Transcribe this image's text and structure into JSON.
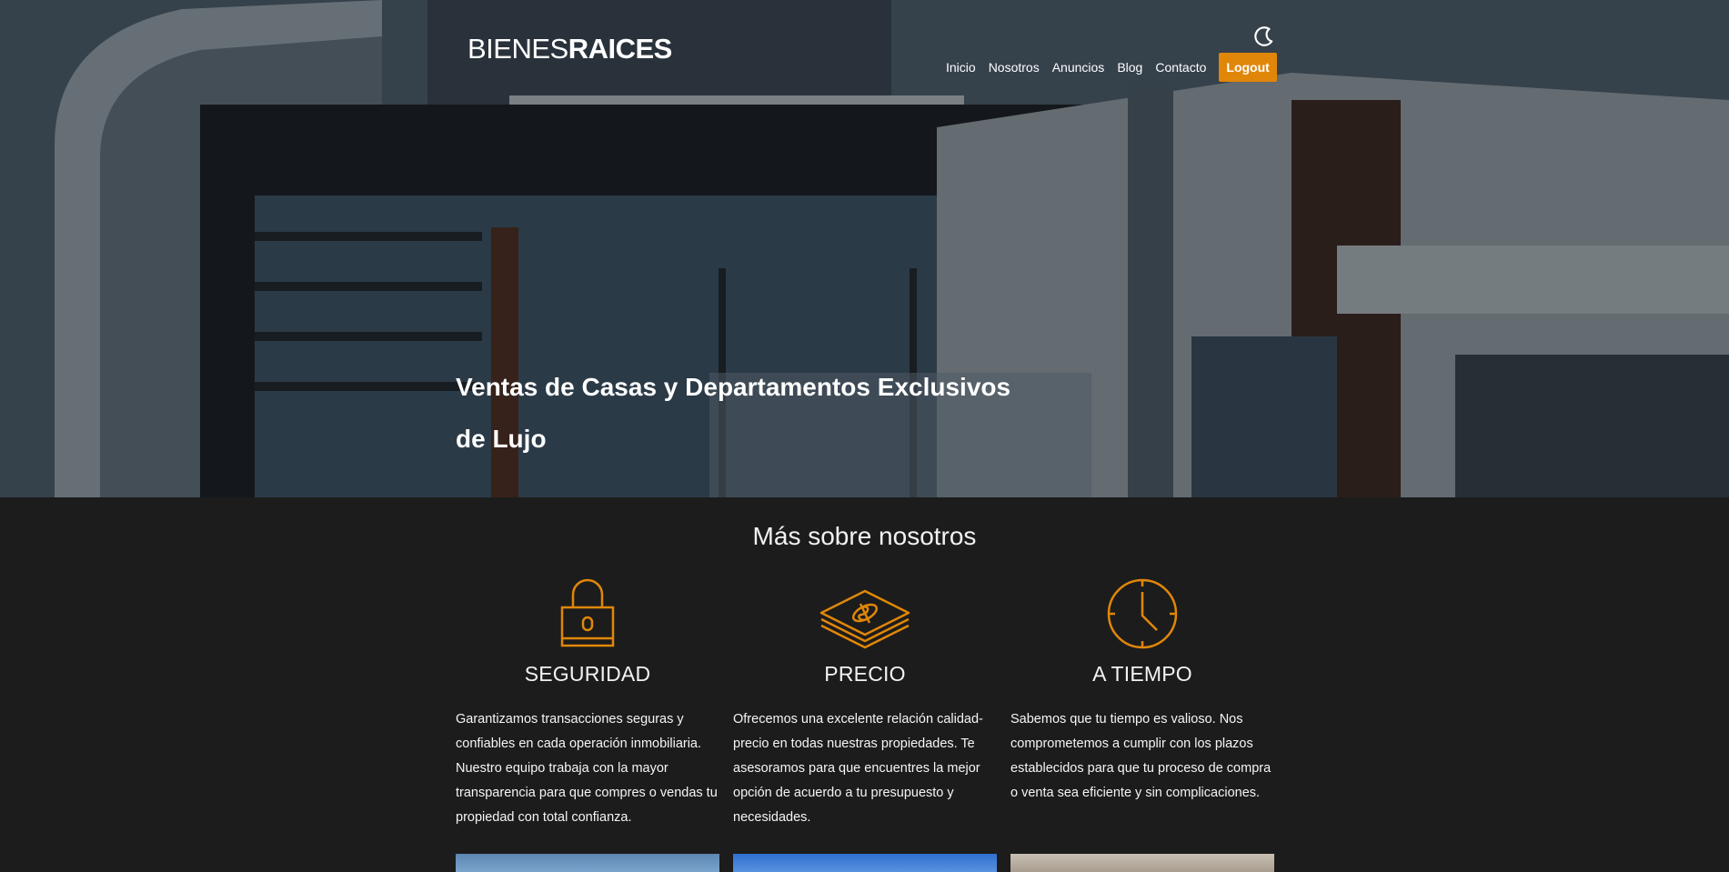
{
  "header": {
    "logo_light": "BIENES",
    "logo_bold": "RAICES",
    "nav": [
      "Inicio",
      "Nosotros",
      "Anuncios",
      "Blog",
      "Contacto"
    ],
    "logout_label": "Logout"
  },
  "hero": {
    "title": "Ventas de Casas y Departamentos Exclusivos de Lujo"
  },
  "about": {
    "title": "Más sobre nosotros",
    "features": [
      {
        "icon": "lock-icon",
        "title": "SEGURIDAD",
        "text": "Garantizamos transacciones seguras y confiables en cada operación inmobiliaria. Nuestro equipo trabaja con la mayor transparencia para que compres o vendas tu propiedad con total confianza."
      },
      {
        "icon": "money-icon",
        "title": "PRECIO",
        "text": "Ofrecemos una excelente relación calidad-precio en todas nuestras propiedades. Te asesoramos para que encuentres la mejor opción de acuerdo a tu presupuesto y necesidades."
      },
      {
        "icon": "clock-icon",
        "title": "A TIEMPO",
        "text": "Sabemos que tu tiempo es valioso. Nos comprometemos a cumplir con los plazos establecidos para que tu proceso de compra o venta sea eficiente y sin complicaciones."
      }
    ]
  },
  "colors": {
    "accent": "#e08709",
    "background": "#1c1c1c"
  }
}
